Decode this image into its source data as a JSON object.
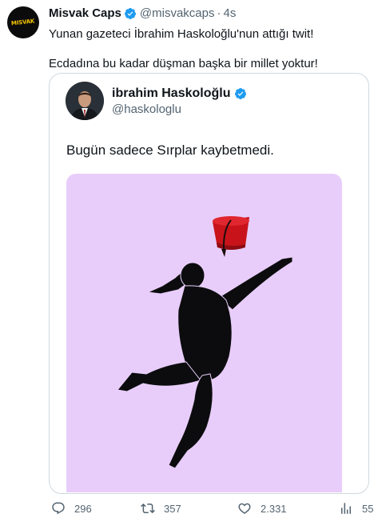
{
  "author": {
    "display_name": "Misvak Caps",
    "handle": "@misvakcaps",
    "separator": "·",
    "time": "4s",
    "avatar_text": "MISVAK"
  },
  "tweet": {
    "line1": "Yunan gazeteci İbrahim Haskoloğlu'nun attığı twit!",
    "line2": "Ecdadına bu kadar düşman başka bir millet yoktur!"
  },
  "quoted": {
    "display_name": "ibrahim Haskoloğlu",
    "handle": "@haskologlu",
    "text": "Bugün sadece Sırplar kaybetmedi."
  },
  "actions": {
    "replies": "296",
    "retweets": "357",
    "likes": "2.331",
    "views": "55"
  },
  "colors": {
    "verified": "#1d9bf0",
    "muted": "#536471",
    "image_bg": "#e8cdfa",
    "fez": "#c8131b"
  }
}
